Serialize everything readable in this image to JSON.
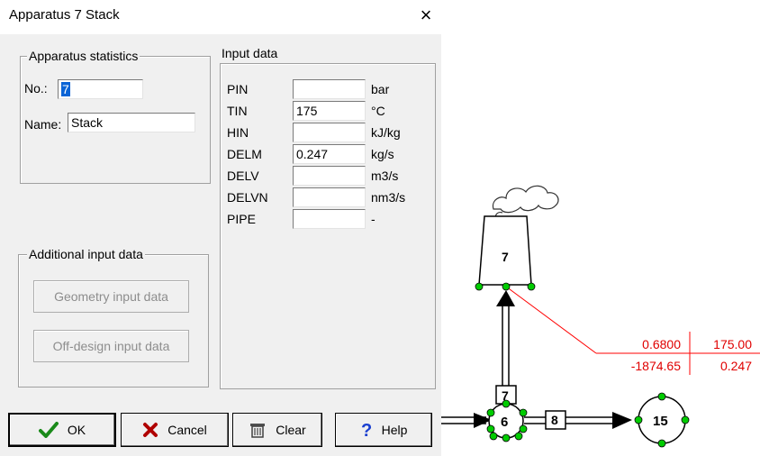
{
  "window": {
    "title": "Apparatus 7  Stack",
    "close_glyph": "×"
  },
  "apparatus_statistics": {
    "group_label": "Apparatus statistics",
    "no_label": "No.:",
    "no_value": "7",
    "name_label": "Name:",
    "name_value": "Stack"
  },
  "input_data": {
    "group_label": "Input data",
    "rows": [
      {
        "label": "PIN",
        "value": "",
        "unit": "bar"
      },
      {
        "label": "TIN",
        "value": "175",
        "unit": "°C"
      },
      {
        "label": "HIN",
        "value": "",
        "unit": "kJ/kg"
      },
      {
        "label": "DELM",
        "value": "0.247",
        "unit": "kg/s"
      },
      {
        "label": "DELV",
        "value": "",
        "unit": "m3/s"
      },
      {
        "label": "DELVN",
        "value": "",
        "unit": "nm3/s"
      },
      {
        "label": "PIPE",
        "value": "",
        "unit": "-"
      }
    ]
  },
  "additional_input": {
    "group_label": "Additional input data",
    "geometry_button": "Geometry input data",
    "offdesign_button": "Off-design input data"
  },
  "buttons": {
    "ok": "OK",
    "cancel": "Cancel",
    "clear": "Clear",
    "help": "Help"
  },
  "icons": [
    "close-icon",
    "checkmark-icon",
    "cross-icon",
    "trash-icon",
    "question-icon",
    "smoke-cloud-icon",
    "arrow-icon"
  ],
  "diagram": {
    "stack_id": "7",
    "pipe_upper_id": "7",
    "node_6": "6",
    "pipe_8": "8",
    "node_15": "15",
    "result_top_left": "0.6800",
    "result_top_right": "175.00",
    "result_bottom_left": "-1874.65",
    "result_bottom_right": "0.247",
    "colors": {
      "result_text": "#e00000",
      "leader_line": "#ff0000",
      "connector_dot": "#00cc00"
    }
  }
}
